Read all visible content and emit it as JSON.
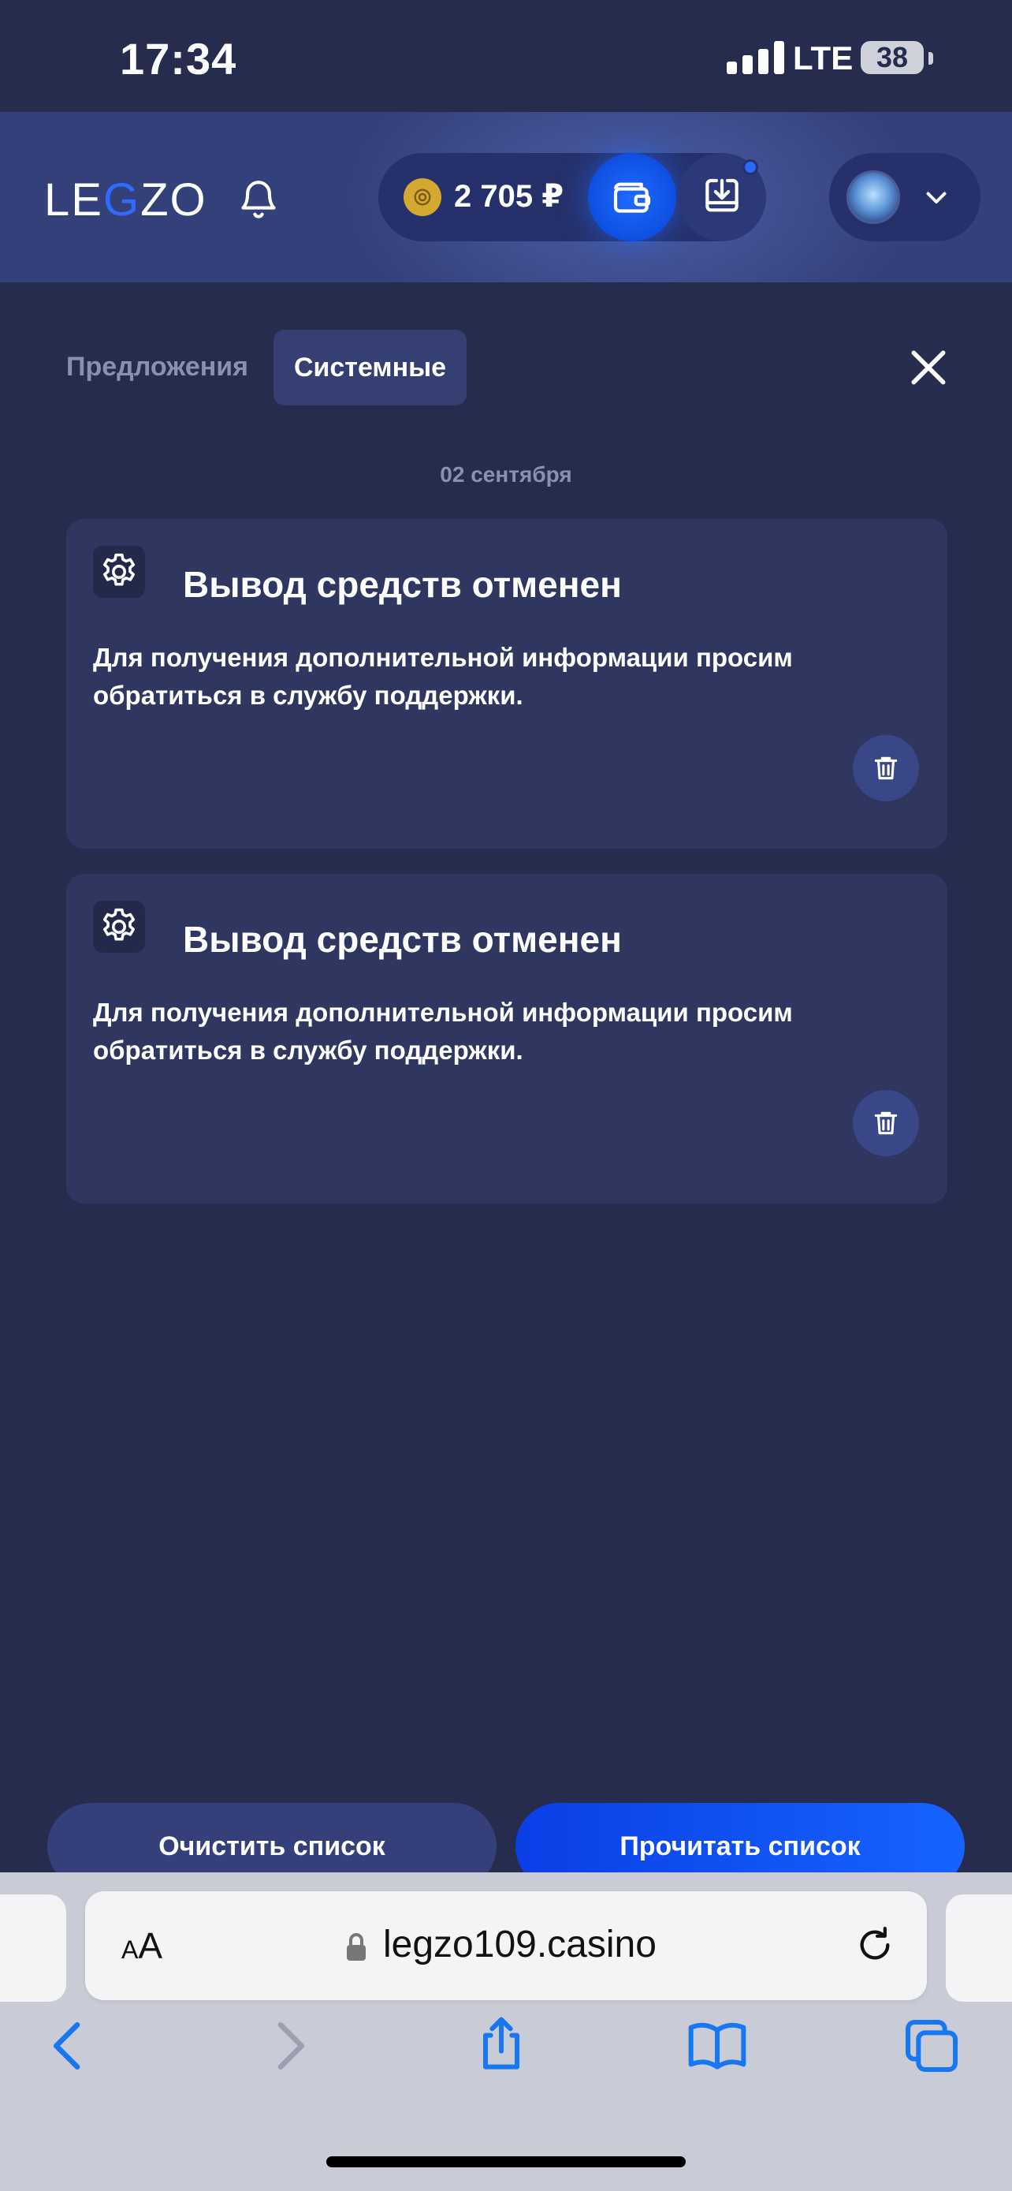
{
  "status_bar": {
    "time": "17:34",
    "network": "LTE",
    "battery": "38"
  },
  "header": {
    "logo_left": "LE",
    "logo_g": "G",
    "logo_right": "ZO",
    "balance": "2 705 ₽",
    "accent_color": "#1d6bff",
    "icons": [
      "bell-icon",
      "coin-icon",
      "wallet-icon",
      "download-icon",
      "avatar",
      "chevron-down-icon"
    ]
  },
  "tabs": [
    {
      "label": "Предложения",
      "active": false
    },
    {
      "label": "Системные",
      "active": true
    }
  ],
  "date_label": "02 сентября",
  "notifications": [
    {
      "title": "Вывод средств отменен",
      "body": "Для получения дополнительной информации просим обратиться в службу поддержки."
    },
    {
      "title": "Вывод средств отменен",
      "body": "Для получения дополнительной информации просим обратиться в службу поддержки."
    }
  ],
  "actions": {
    "clear_label": "Очистить список",
    "read_label": "Прочитать список"
  },
  "browser": {
    "text_size_label_small": "A",
    "text_size_label_big": "A",
    "url": "legzo109.casino"
  }
}
